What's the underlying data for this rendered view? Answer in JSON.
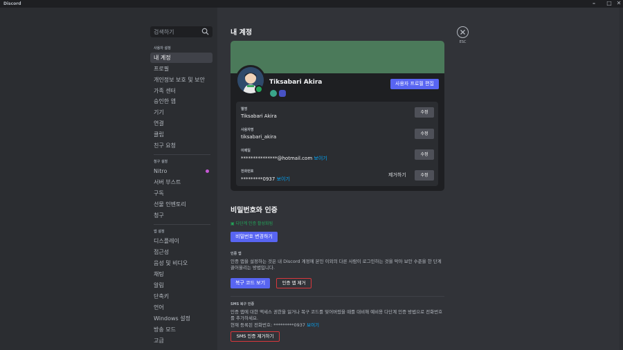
{
  "window": {
    "title": "Discord"
  },
  "search": {
    "placeholder": "검색하기"
  },
  "sidebar": {
    "user_section": "사용자 설정",
    "user_items": [
      {
        "label": "내 계정"
      },
      {
        "label": "프로필"
      },
      {
        "label": "개인정보 보호 및 보안"
      },
      {
        "label": "가족 센터"
      },
      {
        "label": "승인한 앱"
      },
      {
        "label": "기기"
      },
      {
        "label": "연결"
      },
      {
        "label": "클립"
      },
      {
        "label": "친구 요청"
      }
    ],
    "billing_section": "청구 설정",
    "billing_items": [
      {
        "label": "Nitro"
      },
      {
        "label": "서버 부스트"
      },
      {
        "label": "구독"
      },
      {
        "label": "선물 인벤토리"
      },
      {
        "label": "청구"
      }
    ],
    "app_section": "앱 설정",
    "app_items": [
      {
        "label": "디스플레이"
      },
      {
        "label": "접근성"
      },
      {
        "label": "음성 및 비디오"
      },
      {
        "label": "채팅"
      },
      {
        "label": "알림"
      },
      {
        "label": "단축키"
      },
      {
        "label": "언어"
      },
      {
        "label": "Windows 설정"
      },
      {
        "label": "방송 모드"
      },
      {
        "label": "고급"
      }
    ]
  },
  "header": {
    "title": "내 계정",
    "close_label": "ESC"
  },
  "profile": {
    "display_name": "Tiksabari Akira",
    "edit_button": "사용자 프로필 편집",
    "banner_color": "#4b7a5a"
  },
  "fields": {
    "name_label": "별명",
    "name_value": "Tiksabari Akira",
    "username_label": "사용자명",
    "username_value": "tiksabari_akira",
    "email_label": "이메일",
    "email_value": "***************@hotmail.com",
    "phone_label": "전화번호",
    "phone_value": "*********0937",
    "reveal": "보이기",
    "edit": "수정",
    "remove": "제거하기"
  },
  "security": {
    "title": "비밀번호와 인증",
    "mfa_status": "다단계 인증 활성화됨",
    "change_password": "비밀번호 변경하기",
    "auth_app_title": "인증 앱",
    "auth_app_desc": "인증 앱을 설정하는 것은 내 Discord 계정에 본인 이외의 다른 사람이 로그인하는 것을 막아 보안 수준을 한 단계 끌어올리는 방법입니다.",
    "view_backup": "복구 코드 보기",
    "remove_auth": "인증 앱 제거",
    "sms_title": "SMS 복구 인증",
    "sms_desc": "인증 앱에 대한 액세스 권한을 잃거나 복구 코드를 잊어버렸을 때를 대비해 예비용 다단계 인증 방법으로 전화번호를 추가하세요.",
    "current_phone_prefix": "현재 등록된 전화번호: ",
    "current_phone": "*********0937",
    "remove_sms": "SMS 인증 제거하기"
  },
  "colors": {
    "accent": "#5865f2",
    "danger": "#da373c",
    "online": "#23a55a",
    "link": "#00a8fc"
  }
}
